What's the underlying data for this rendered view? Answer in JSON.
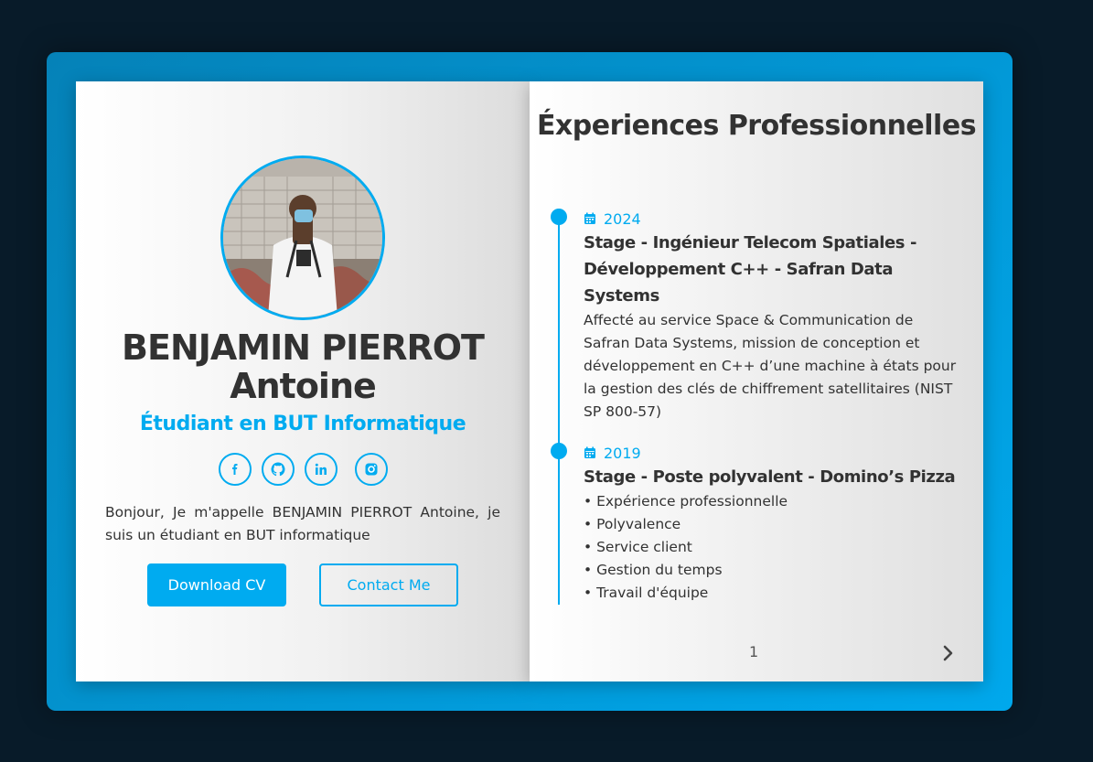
{
  "profile": {
    "name": "BENJAMIN PIERROT Antoine",
    "subtitle": "Étudiant en BUT Informatique",
    "intro": "Bonjour, Je m'appelle BENJAMIN PIERROT Antoine, je suis un étudiant en BUT informatique",
    "avatar_alt": "profile photo",
    "socials": [
      {
        "icon": "facebook-icon"
      },
      {
        "icon": "github-icon"
      },
      {
        "icon": "linkedin-icon"
      },
      {
        "icon": "instagram-icon"
      }
    ],
    "download_label": "Download CV",
    "contact_label": "Contact Me"
  },
  "experiences": {
    "title": "Éxperiences Professionnelles",
    "items": [
      {
        "year": "2024",
        "job": "Stage - Ingénieur Telecom Spatiales - Développement C++ - Safran Data Systems",
        "desc": "Affecté au service Space & Communication de Safran Data Systems, mission de conception et développement en C++ d’une machine à états pour la gestion des clés de chiffrement satellitaires (NIST SP 800-57)"
      },
      {
        "year": "2019",
        "job": "Stage - Poste polyvalent - Domino’s Pizza",
        "bullets": [
          "• Expérience professionnelle",
          "• Polyvalence",
          "• Service client",
          "• Gestion du temps",
          "• Travail d'équipe"
        ]
      }
    ],
    "page_number": "1"
  },
  "colors": {
    "accent": "#00abf0",
    "background": "#081b29",
    "text": "#323232"
  }
}
